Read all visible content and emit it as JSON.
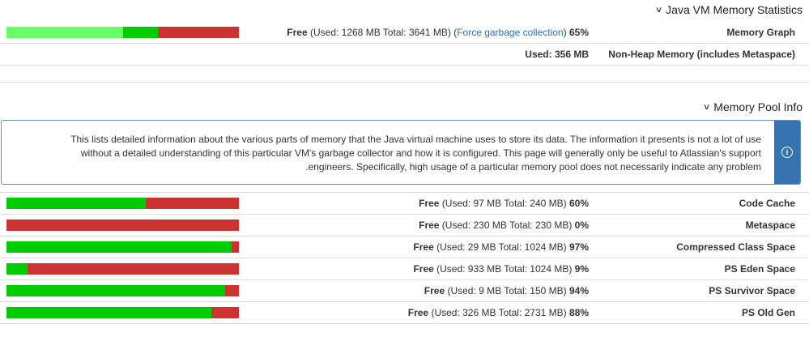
{
  "jvm_section": {
    "title": "Java VM Memory Statistics",
    "memory_graph": {
      "label": "Memory Graph",
      "free_label": "Free",
      "details": "(Used: 1268 MB Total: 3641 MB)",
      "gc_link": "Force garbage collection",
      "percent": "65%",
      "bar": [
        {
          "color": "#66ff66",
          "fraction": 0.5
        },
        {
          "color": "#00cc00",
          "fraction": 0.15
        },
        {
          "color": "#cc3333",
          "fraction": 0.35
        }
      ]
    },
    "non_heap": {
      "label": "Non-Heap Memory (includes Metaspace)",
      "used_text": "Used: 356 MB"
    }
  },
  "pool_section": {
    "title": "Memory Pool Info",
    "info_message": "This lists detailed information about the various parts of memory that the Java virtual machine uses to store its data. The information it presents is not a lot of use without a detailed understanding of this particular VM's garbage collector and how it is configured. This page will generally only be useful to Atlassian's support engineers. Specifically, high usage of a particular memory pool does not necessarily indicate any problem.",
    "info_icon": "info-icon",
    "pools": [
      {
        "name": "Code Cache",
        "free_label": "Free",
        "details": "(Used: 97 MB Total: 240 MB)",
        "percent": "60%",
        "free_fraction": 0.6
      },
      {
        "name": "Metaspace",
        "free_label": "Free",
        "details": "(Used: 230 MB Total: 230 MB)",
        "percent": "0%",
        "free_fraction": 0.0
      },
      {
        "name": "Compressed Class Space",
        "free_label": "Free",
        "details": "(Used: 29 MB Total: 1024 MB)",
        "percent": "97%",
        "free_fraction": 0.97
      },
      {
        "name": "PS Eden Space",
        "free_label": "Free",
        "details": "(Used: 933 MB Total: 1024 MB)",
        "percent": "9%",
        "free_fraction": 0.09
      },
      {
        "name": "PS Survivor Space",
        "free_label": "Free",
        "details": "(Used: 9 MB Total: 150 MB)",
        "percent": "94%",
        "free_fraction": 0.94
      },
      {
        "name": "PS Old Gen",
        "free_label": "Free",
        "details": "(Used: 326 MB Total: 2731 MB)",
        "percent": "88%",
        "free_fraction": 0.88
      }
    ]
  },
  "colors": {
    "free": "#00cc00",
    "used": "#cc3333",
    "link": "#2a6ebb",
    "info_accent": "#3572b0"
  }
}
